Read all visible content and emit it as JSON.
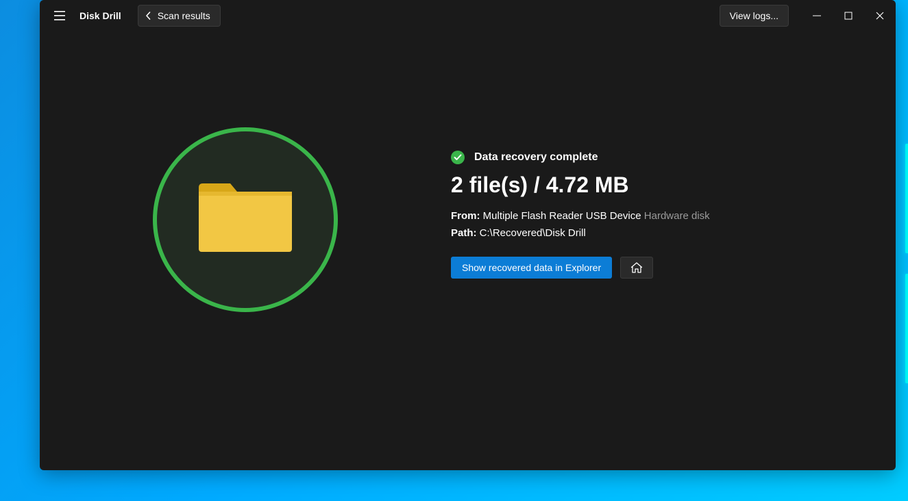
{
  "header": {
    "app_title": "Disk Drill",
    "back_label": "Scan results",
    "view_logs_label": "View logs..."
  },
  "result": {
    "status_text": "Data recovery complete",
    "headline": "2 file(s) / 4.72 MB",
    "from_label": "From:",
    "from_value": "Multiple Flash Reader USB Device",
    "from_hint": "Hardware disk",
    "path_label": "Path:",
    "path_value": "C:\\Recovered\\Disk Drill",
    "show_button": "Show recovered data in Explorer"
  }
}
